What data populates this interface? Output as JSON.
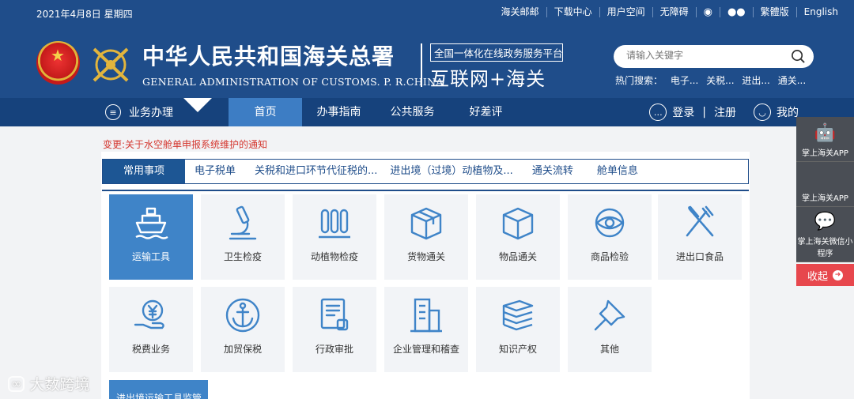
{
  "header": {
    "date": "2021年4月8日  星期四",
    "top_links": [
      "海关邮邮",
      "下载中心",
      "用户空间",
      "无障碍",
      "繁體版",
      "English"
    ],
    "title_cn": "中华人民共和国海关总署",
    "title_en": "GENERAL ADMINISTRATION OF CUSTOMS. P. R.CHINA",
    "platform_top": "全国一体化在线政务服务平台",
    "platform_big": "互联网+海关",
    "search_placeholder": "请输入关键字",
    "hot_label": "热门搜索：",
    "hot_items": [
      "电子...",
      "关税...",
      "进出...",
      "通关..."
    ]
  },
  "nav": {
    "business": "业务办理",
    "tabs": [
      "首页",
      "办事指南",
      "公共服务",
      "好差评"
    ],
    "login": "登录",
    "sep": "|",
    "register": "注册",
    "mine": "我的"
  },
  "notice": "变更:关于水空舱单申报系统维护的通知",
  "tabs": [
    "常用事项",
    "电子税单",
    "关税和进口环节代征税的...",
    "进出境（过境）动植物及...",
    "通关流转",
    "舱单信息"
  ],
  "tiles": [
    {
      "label": "运输工具",
      "icon": "ship-icon"
    },
    {
      "label": "卫生检疫",
      "icon": "microscope-icon"
    },
    {
      "label": "动植物检疫",
      "icon": "test-tubes-icon"
    },
    {
      "label": "货物通关",
      "icon": "cargo-box-icon"
    },
    {
      "label": "物品通关",
      "icon": "cube-icon"
    },
    {
      "label": "商品检验",
      "icon": "eye-inspect-icon"
    },
    {
      "label": "进出口食品",
      "icon": "fork-knife-icon"
    },
    {
      "label": "税费业务",
      "icon": "yuan-hand-icon"
    },
    {
      "label": "加贸保税",
      "icon": "anchor-icon"
    },
    {
      "label": "行政审批",
      "icon": "approval-doc-icon"
    },
    {
      "label": "企业管理和稽查",
      "icon": "building-icon"
    },
    {
      "label": "知识产权",
      "icon": "books-icon"
    },
    {
      "label": "其他",
      "icon": "pin-icon"
    }
  ],
  "bottom_tab": "进出境运输工具监管",
  "side": {
    "app1": "掌上海关APP",
    "app2": "掌上海关APP",
    "mini": "掌上海关微信小程序",
    "close": "收起"
  },
  "watermark": "大数跨境"
}
